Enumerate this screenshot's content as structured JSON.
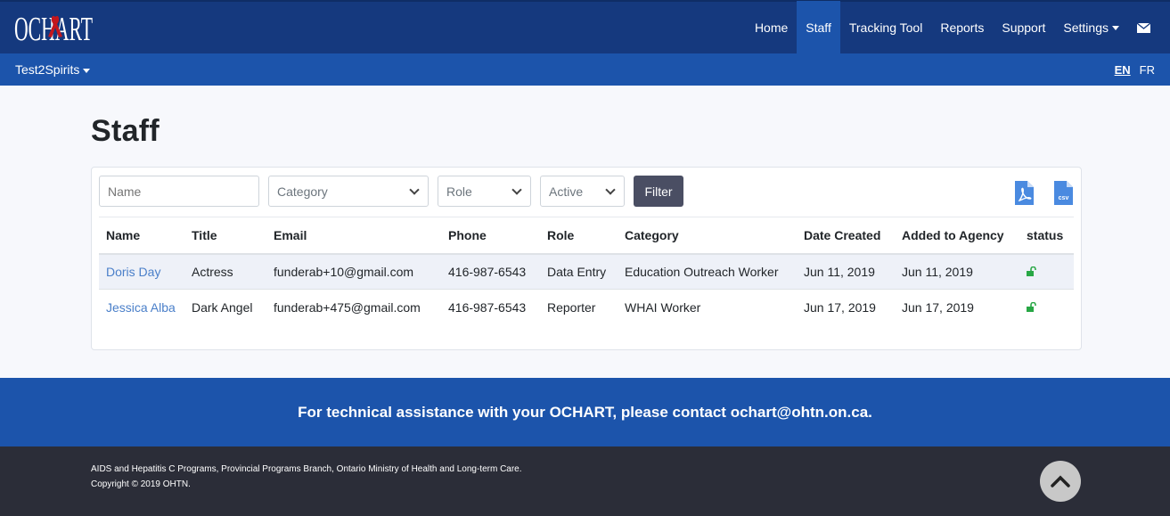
{
  "brand": {
    "logo_text": "OCHART",
    "colors": {
      "nav_dark": "#15397e",
      "nav_primary": "#1c54ab",
      "link": "#4a7fc9",
      "footer": "#2b2d38",
      "status_green": "#28a745",
      "export_icon": "#4a8ae0"
    }
  },
  "nav": {
    "items": [
      {
        "label": "Home"
      },
      {
        "label": "Staff",
        "active": true
      },
      {
        "label": "Tracking Tool"
      },
      {
        "label": "Reports"
      },
      {
        "label": "Support"
      },
      {
        "label": "Settings"
      }
    ],
    "mail_icon": "envelope-icon"
  },
  "subnav": {
    "agency": "Test2Spirits",
    "lang": [
      "EN",
      "FR"
    ],
    "current_lang": "EN"
  },
  "page": {
    "title": "Staff"
  },
  "filters": {
    "name_placeholder": "Name",
    "category": "Category",
    "role": "Role",
    "active": "Active",
    "button": "Filter"
  },
  "exports": {
    "pdf": "pdf-icon",
    "csv_label": "csv"
  },
  "table": {
    "headers": [
      "Name",
      "Title",
      "Email",
      "Phone",
      "Role",
      "Category",
      "Date Created",
      "Added to Agency",
      "status"
    ],
    "rows": [
      {
        "name": "Doris Day",
        "title": "Actress",
        "email": "funderab+10@gmail.com",
        "phone": "416-987-6543",
        "role": "Data Entry",
        "category": "Education Outreach Worker",
        "date_created": "Jun 11, 2019",
        "added": "Jun 11, 2019",
        "status": "unlocked"
      },
      {
        "name": "Jessica Alba",
        "title": "Dark Angel",
        "email": "funderab+475@gmail.com",
        "phone": "416-987-6543",
        "role": "Reporter",
        "category": "WHAI Worker",
        "date_created": "Jun 17, 2019",
        "added": "Jun 17, 2019",
        "status": "unlocked"
      }
    ]
  },
  "help": {
    "text": "For technical assistance with your OCHART, please contact ochart@ohtn.on.ca."
  },
  "footer": {
    "line1": "AIDS and Hepatitis C Programs, Provincial Programs Branch, Ontario Ministry of Health and Long-term Care.",
    "line2": "Copyright © 2019 OHTN."
  }
}
